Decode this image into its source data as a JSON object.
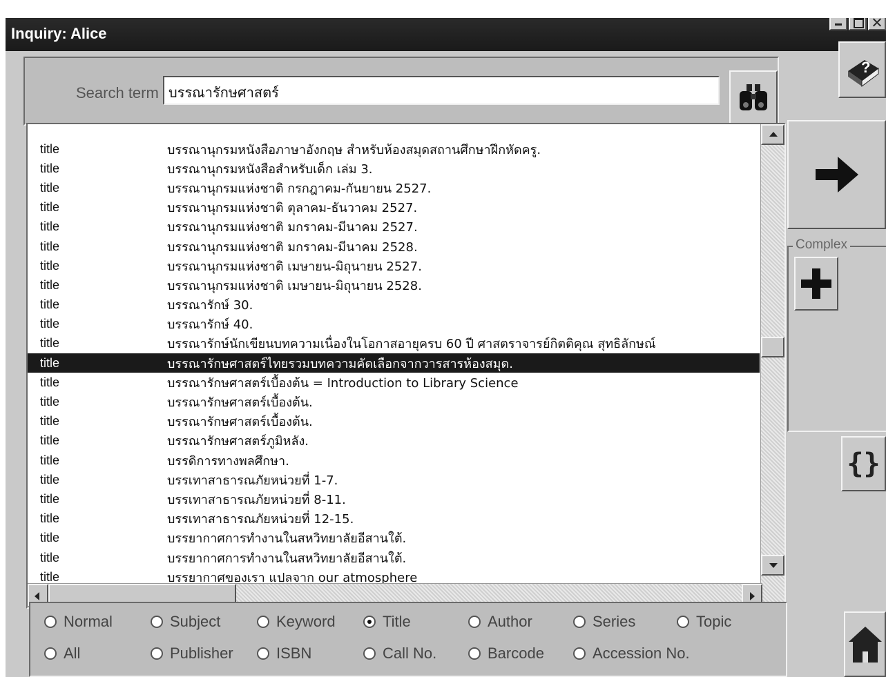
{
  "window": {
    "title": "Inquiry: Alice"
  },
  "search": {
    "label": "Search term",
    "value": "บรรณารักษศาสตร์"
  },
  "results": [
    {
      "field": "title",
      "value": "บรรณานุกรมหนังสือภาษาอังกฤษ สำหรับห้องสมุดสถานศึกษาฝึกหัดครู."
    },
    {
      "field": "title",
      "value": "บรรณานุกรมหนังสือสำหรับเด็ก เล่ม 3."
    },
    {
      "field": "title",
      "value": "บรรณานุกรมแห่งชาติ กรกฎาคม-กันยายน 2527."
    },
    {
      "field": "title",
      "value": "บรรณานุกรมแห่งชาติ ตุลาคม-ธันวาคม 2527."
    },
    {
      "field": "title",
      "value": "บรรณานุกรมแห่งชาติ มกราคม-มีนาคม 2527."
    },
    {
      "field": "title",
      "value": "บรรณานุกรมแห่งชาติ มกราคม-มีนาคม 2528."
    },
    {
      "field": "title",
      "value": "บรรณานุกรมแห่งชาติ เมษายน-มิถุนายน 2527."
    },
    {
      "field": "title",
      "value": "บรรณานุกรมแห่งชาติ เมษายน-มิถุนายน 2528."
    },
    {
      "field": "title",
      "value": "บรรณารักษ์ 30."
    },
    {
      "field": "title",
      "value": "บรรณารักษ์ 40."
    },
    {
      "field": "title",
      "value": "บรรณารักษ์นักเขียนบทความเนื่องในโอกาสอายุครบ 60 ปี ศาสตราจารย์กิตติคุณ สุทธิลักษณ์"
    },
    {
      "field": "title",
      "value": "บรรณารักษศาสตร์ไทยรวมบทความคัดเลือกจากวารสารห้องสมุด.",
      "selected": true
    },
    {
      "field": "title",
      "value": "บรรณารักษศาสตร์เบื้องต้น = Introduction to Library Science"
    },
    {
      "field": "title",
      "value": "บรรณารักษศาสตร์เบื้องต้น."
    },
    {
      "field": "title",
      "value": "บรรณารักษศาสตร์เบื้องต้น."
    },
    {
      "field": "title",
      "value": "บรรณารักษศาสตร์ภูมิหลัง."
    },
    {
      "field": "title",
      "value": "บรรดิการทางพลศึกษา."
    },
    {
      "field": "title",
      "value": "บรรเทาสาธารณภัยหน่วยที่ 1-7."
    },
    {
      "field": "title",
      "value": "บรรเทาสาธารณภัยหน่วยที่ 8-11."
    },
    {
      "field": "title",
      "value": "บรรเทาสาธารณภัยหน่วยที่ 12-15."
    },
    {
      "field": "title",
      "value": "บรรยากาศการทำงานในสหวิทยาลัยอีสานใต้."
    },
    {
      "field": "title",
      "value": "บรรยากาศการทำงานในสหวิทยาลัยอีสานใต้."
    },
    {
      "field": "title",
      "value": "บรรยากาศของเรา แปลจาก our atmosphere"
    }
  ],
  "side": {
    "complex_label": "Complex"
  },
  "options": {
    "row1": [
      "Normal",
      "Subject",
      "Keyword",
      "Title",
      "Author",
      "Series",
      "Topic"
    ],
    "row2": [
      "All",
      "Publisher",
      "ISBN",
      "Call No.",
      "Barcode",
      "Accession No."
    ],
    "selected": "Title"
  },
  "icons": [
    "binoculars-icon",
    "help-book-icon",
    "right-arrow-icon",
    "plus-icon",
    "braces-icon",
    "home-icon"
  ],
  "colors": {
    "titlebar": "#1a1a1a",
    "selection": "#1a1a1a",
    "window": "#c9c9c9"
  }
}
